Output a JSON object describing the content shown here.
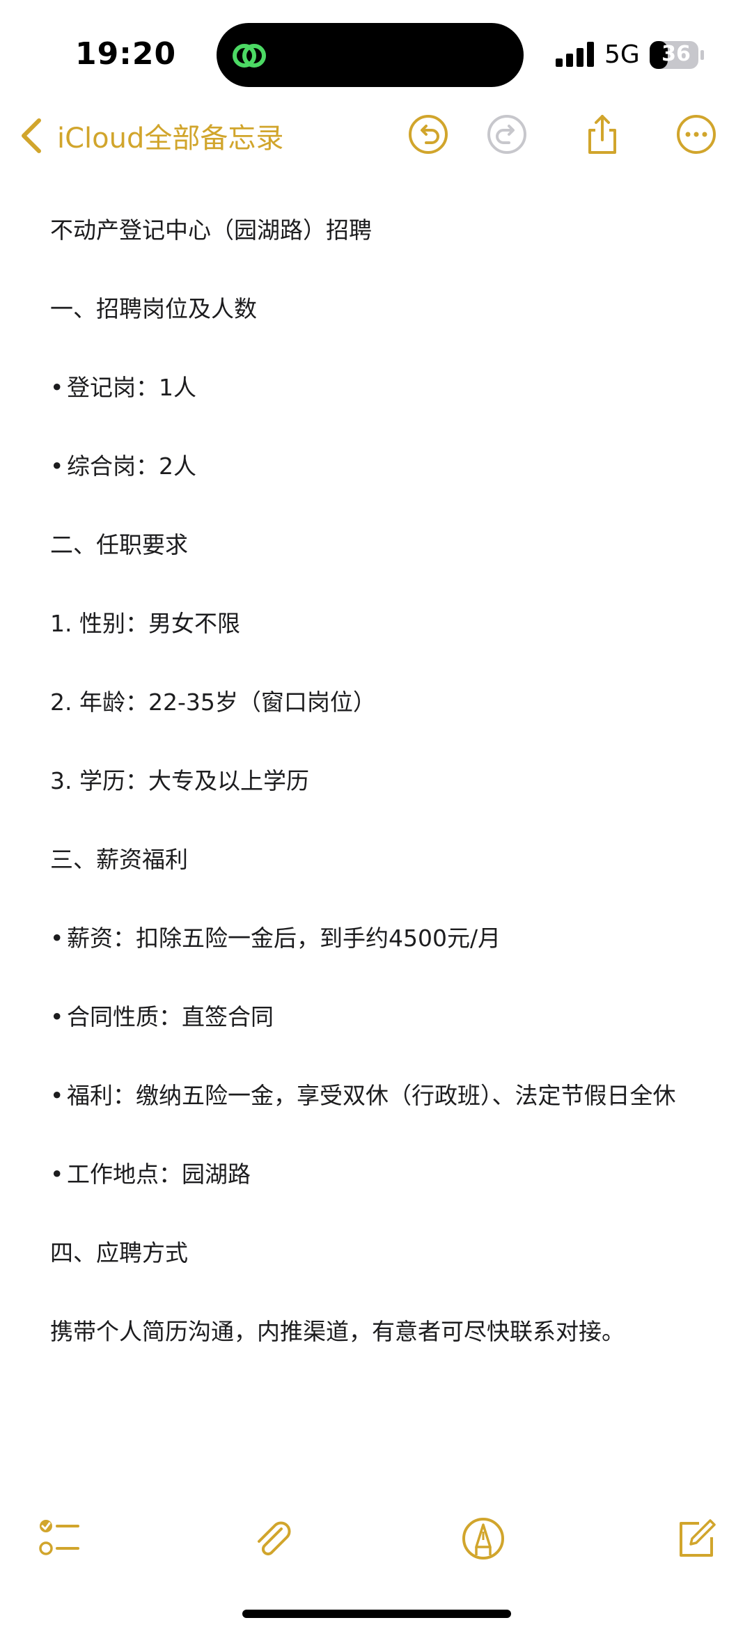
{
  "status_bar": {
    "time": "19:20",
    "network": "5G",
    "battery": "36"
  },
  "nav": {
    "back_label": "iCloud全部备忘录",
    "accent_color": "#d1a52c",
    "icons": [
      "chevron-left-icon",
      "undo-icon",
      "redo-icon",
      "share-icon",
      "more-icon"
    ]
  },
  "note": {
    "lines": [
      {
        "text": "不动产登记中心（园湖路）招聘",
        "bullet": false
      },
      {
        "text": "一、招聘岗位及人数",
        "bullet": false
      },
      {
        "text": "登记岗：1人",
        "bullet": true
      },
      {
        "text": "综合岗：2人",
        "bullet": true
      },
      {
        "text": "二、任职要求",
        "bullet": false
      },
      {
        "text": "1. 性别：男女不限",
        "bullet": false
      },
      {
        "text": "2. 年龄：22-35岁（窗口岗位）",
        "bullet": false
      },
      {
        "text": "3. 学历：大专及以上学历",
        "bullet": false
      },
      {
        "text": "三、薪资福利",
        "bullet": false
      },
      {
        "text": "薪资：扣除五险一金后，到手约4500元/月",
        "bullet": true
      },
      {
        "text": "合同性质：直签合同",
        "bullet": true
      },
      {
        "text": "福利：缴纳五险一金，享受双休（行政班）、法定节假日全休",
        "bullet": true
      },
      {
        "text": "工作地点：园湖路",
        "bullet": true
      },
      {
        "text": "四、应聘方式",
        "bullet": false
      },
      {
        "text": "携带个人简历沟通，内推渠道，有意者可尽快联系对接。",
        "bullet": false
      }
    ],
    "bullet_char": "•"
  },
  "toolbar": {
    "icons": [
      "checklist-icon",
      "attachment-icon",
      "markup-icon",
      "compose-icon"
    ]
  }
}
